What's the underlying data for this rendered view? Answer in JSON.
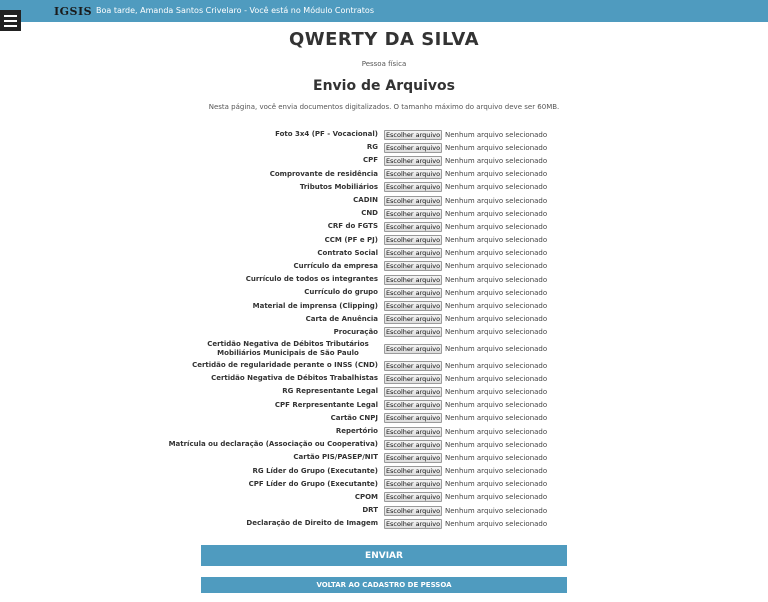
{
  "header": {
    "logo": "IGSIS",
    "greeting": "Boa tarde, Amanda Santos Crivelaro - Você está no Módulo Contratos",
    "menu_icon": "hamburger-menu-icon"
  },
  "person": {
    "name": "QWERTY DA SILVA",
    "type": "Pessoa física"
  },
  "page": {
    "title": "Envio de Arquivos",
    "intro": "Nesta página, você envia documentos digitalizados. O tamanho máximo do arquivo deve ser 60MB."
  },
  "file_input": {
    "button_label": "Escolher arquivo",
    "status": "Nenhum arquivo selecionado"
  },
  "documents": [
    "Foto 3x4 (PF - Vocacional)",
    "RG",
    "CPF",
    "Comprovante de residência",
    "Tributos Mobiliários",
    "CADIN",
    "CND",
    "CRF do FGTS",
    "CCM (PF e PJ)",
    "Contrato Social",
    "Currículo da empresa",
    "Currículo de todos os integrantes",
    "Currículo do grupo",
    "Material de imprensa (Clipping)",
    "Carta de Anuência",
    "Procuração",
    "Certidão Negativa de Débitos Tributários Mobiliários Municipais de São Paulo",
    "Certidão de regularidade perante o INSS (CND)",
    "Certidão Negativa de Débitos Trabalhistas",
    "RG Representante Legal",
    "CPF Rerpresentante Legal",
    "Cartão CNPJ",
    "Repertório",
    "Matrícula ou declaração (Associação ou Cooperativa)",
    "Cartão PIS/PASEP/NIT",
    "RG Líder do Grupo (Executante)",
    "CPF Líder do Grupo (Executante)",
    "CPOM",
    "DRT",
    "Declaração de Direito de Imagem"
  ],
  "actions": {
    "submit": "ENVIAR",
    "back": "VOLTAR AO CADASTRO DE PESSOA"
  },
  "colors": {
    "accent": "#4f9bbf",
    "menu_button": "#222222"
  }
}
